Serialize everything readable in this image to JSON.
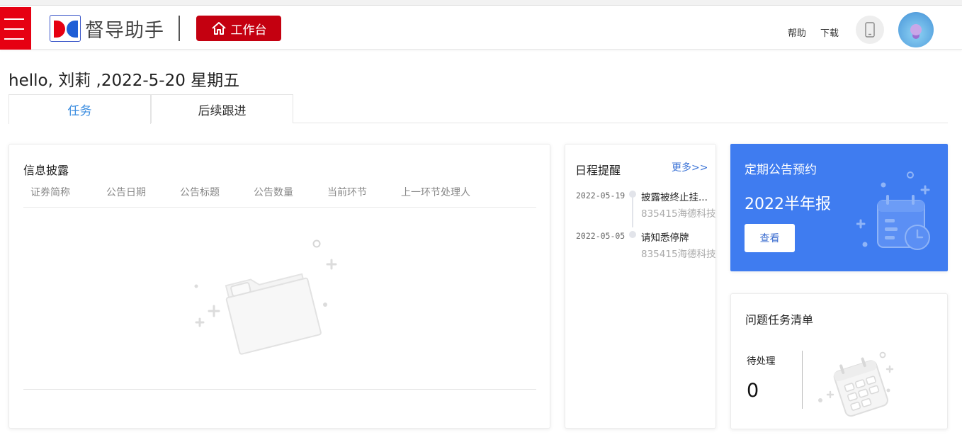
{
  "header": {
    "menu_icon": "hamburger-menu-icon",
    "logo_text": "督导助手",
    "workbench_label": "工作台",
    "help_label": "帮助",
    "download_label": "下载",
    "accent_color": "#e60012"
  },
  "greeting": "hello, 刘莉 ,2022-5-20 星期五",
  "tabs": [
    {
      "label": "任务",
      "active": true
    },
    {
      "label": "后续跟进",
      "active": false
    }
  ],
  "disclosure": {
    "title": "信息披露",
    "columns": [
      "证券简称",
      "公告日期",
      "公告标题",
      "公告数量",
      "当前环节",
      "上一环节处理人"
    ]
  },
  "schedule": {
    "title": "日程提醒",
    "more_label": "更多>>",
    "items": [
      {
        "date": "2022-05-19",
        "title": "披露被终止挂...",
        "subtitle": "835415海德科技"
      },
      {
        "date": "2022-05-05",
        "title": "请知悉停牌",
        "subtitle": "835415海德科技"
      }
    ]
  },
  "periodic": {
    "title": "定期公告预约",
    "value": "2022半年报",
    "button_label": "查看",
    "bg_color": "#3f7cf0"
  },
  "issues": {
    "title": "问题任务清单",
    "pending_label": "待处理",
    "pending_count": "0"
  }
}
